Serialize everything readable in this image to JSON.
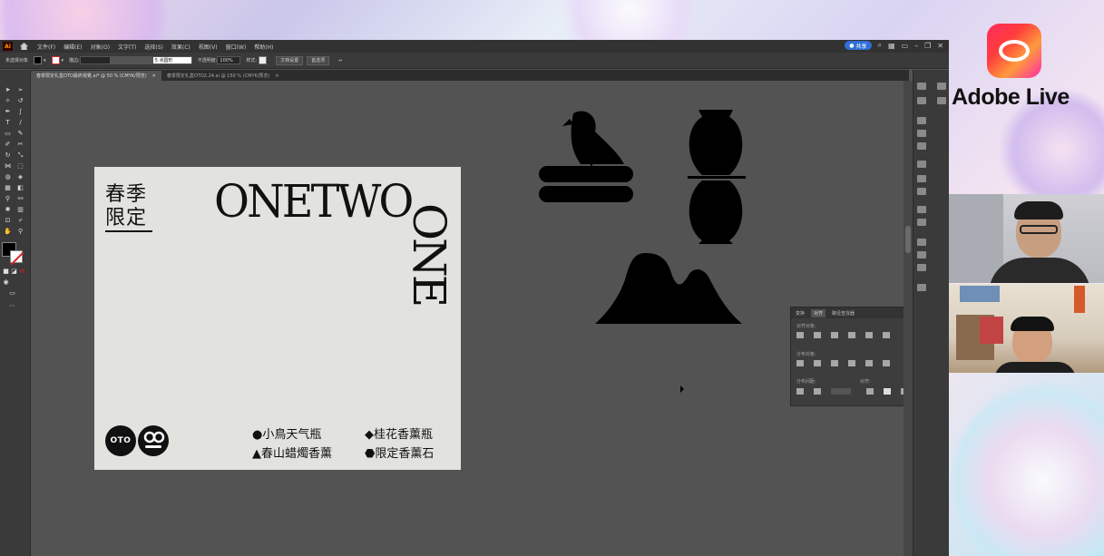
{
  "menubar": {
    "app_badge": "Ai",
    "items": [
      "文件(F)",
      "编辑(E)",
      "对象(O)",
      "文字(T)",
      "选择(S)",
      "效果(C)",
      "视图(V)",
      "窗口(W)",
      "帮助(H)"
    ],
    "share_label": "共享"
  },
  "controlbar": {
    "selection_label": "未选择对象",
    "stroke_label": "描边:",
    "brush_label": "5 点圆形",
    "opacity_label": "不透明度:",
    "opacity_value": "100%",
    "style_label": "样式:",
    "doc_settings": "文档设置",
    "preferences": "首选项"
  },
  "tabs": [
    {
      "label": "春季限定礼盒OTO最終視覺.ai* @ 50 % (CMYK/预览)",
      "active": true
    },
    {
      "label": "春季限定礼盒OTO2.24.ai @ 150 % (CMYK/预览)",
      "active": false
    }
  ],
  "artboard": {
    "title_line1": "春季",
    "title_line2": "限定",
    "big_word": "ONETWO",
    "vertical_word": "ONE",
    "logo_text": "OTO",
    "products": [
      "●小鳥天气瓶",
      "◆桂花香薰瓶",
      "▲春山蜡燭香薰",
      "⬣限定香薰石"
    ]
  },
  "align_panel": {
    "tabs": [
      "变换",
      "对齐",
      "路径查找器"
    ],
    "row1": "对齐对象:",
    "row2": "分布对象:",
    "row3": "分布间距:",
    "row3b": "对齐:"
  },
  "sidebar": {
    "brand": "Adobe Live"
  },
  "colors": {
    "ai_bg": "#535353",
    "panel": "#3a3a3a",
    "share": "#2f6fd6",
    "artboard": "#e2e2df"
  }
}
